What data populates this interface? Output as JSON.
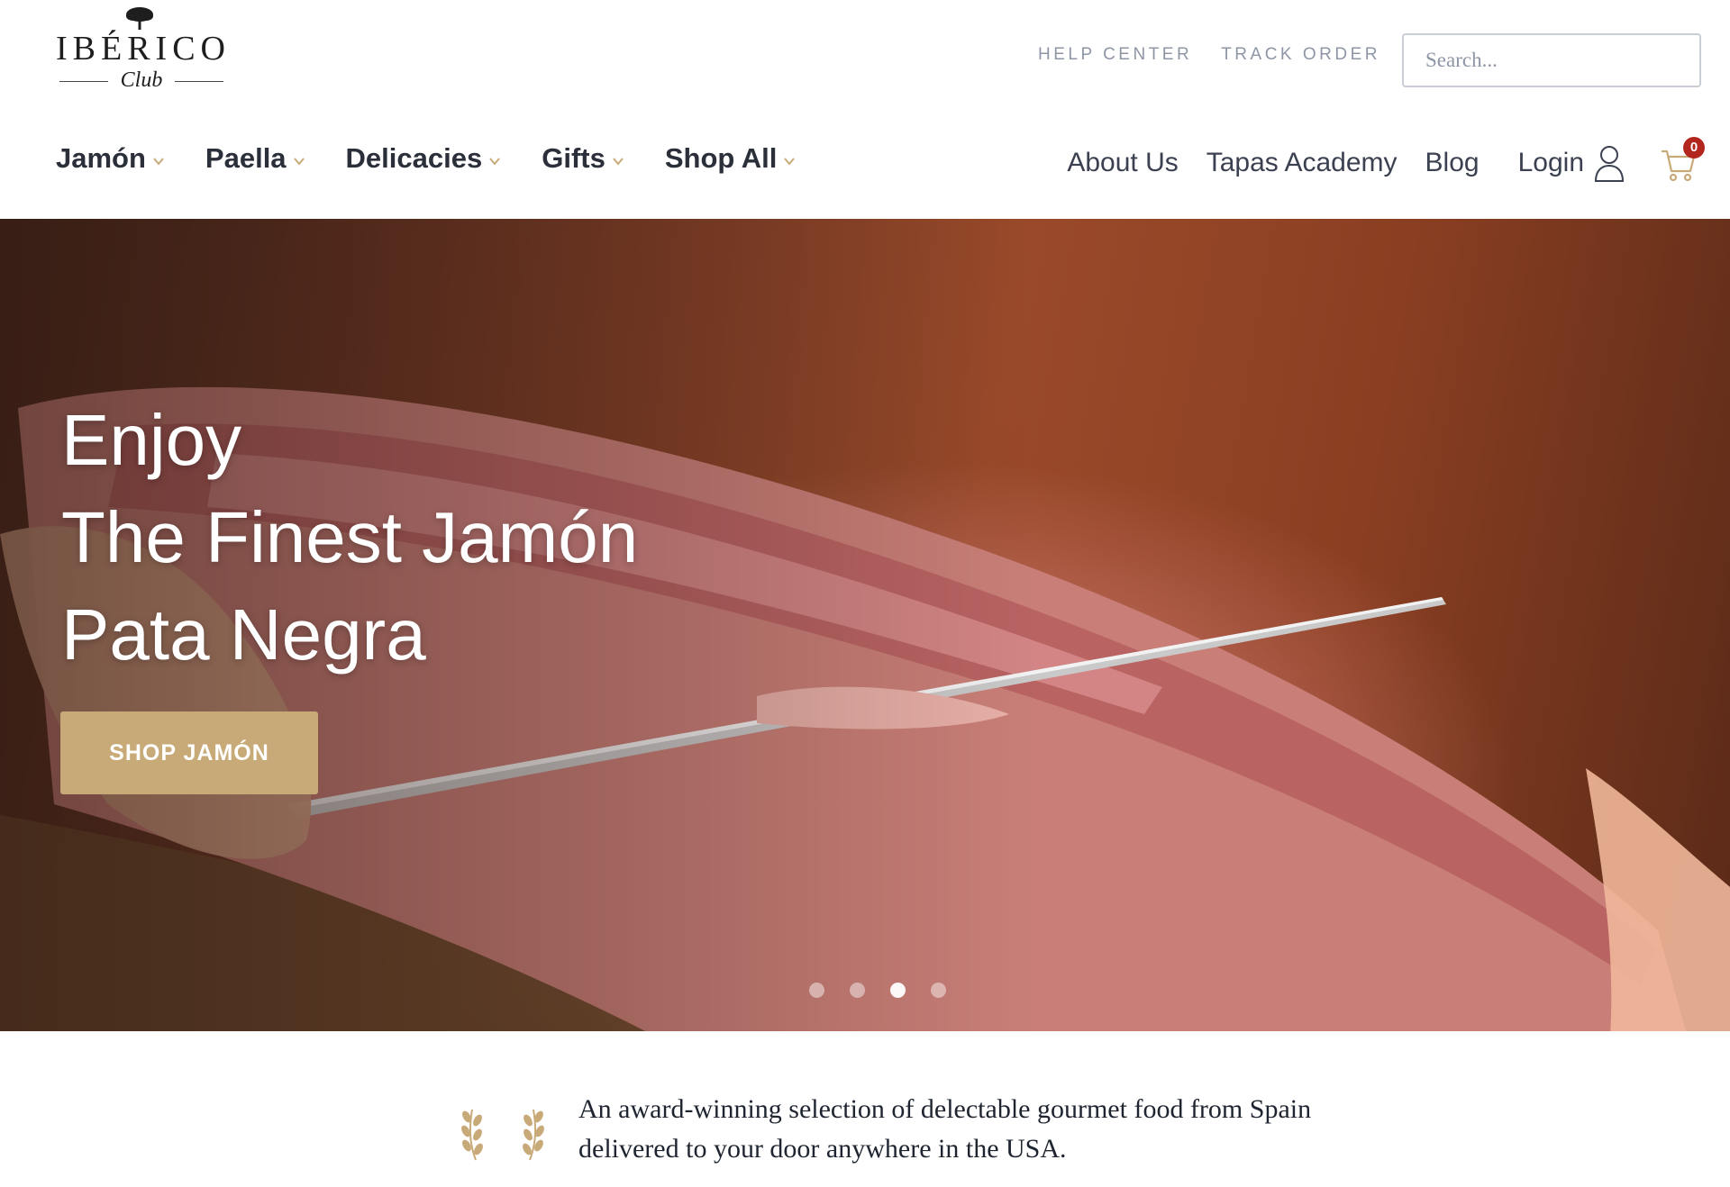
{
  "brand": {
    "name": "IBÉRICO",
    "sub": "Club",
    "accent_color": "#c8aa78",
    "cart_badge_color": "#b3261e"
  },
  "utility_nav": {
    "help_center": "HELP CENTER",
    "track_order": "TRACK ORDER"
  },
  "search": {
    "placeholder": "Search..."
  },
  "main_nav": {
    "items": [
      {
        "label": "Jamón",
        "icon": "chevron-down-icon"
      },
      {
        "label": "Paella",
        "icon": "chevron-down-icon"
      },
      {
        "label": "Delicacies",
        "icon": "chevron-down-icon"
      },
      {
        "label": "Gifts",
        "icon": "chevron-down-icon"
      },
      {
        "label": "Shop All",
        "icon": "chevron-down-icon"
      }
    ]
  },
  "right_nav": {
    "about": "About Us",
    "tapas": "Tapas Academy",
    "blog": "Blog",
    "login": "Login",
    "cart_count": "0"
  },
  "hero": {
    "line1": "Enjoy",
    "line2": "The Finest Jamón",
    "line3": "Pata Negra",
    "cta": "SHOP JAMÓN",
    "slide_count": 4,
    "active_slide": 3
  },
  "tagline": {
    "text": "An award-winning selection of delectable gourmet food from Spain delivered to your door anywhere in the USA."
  }
}
